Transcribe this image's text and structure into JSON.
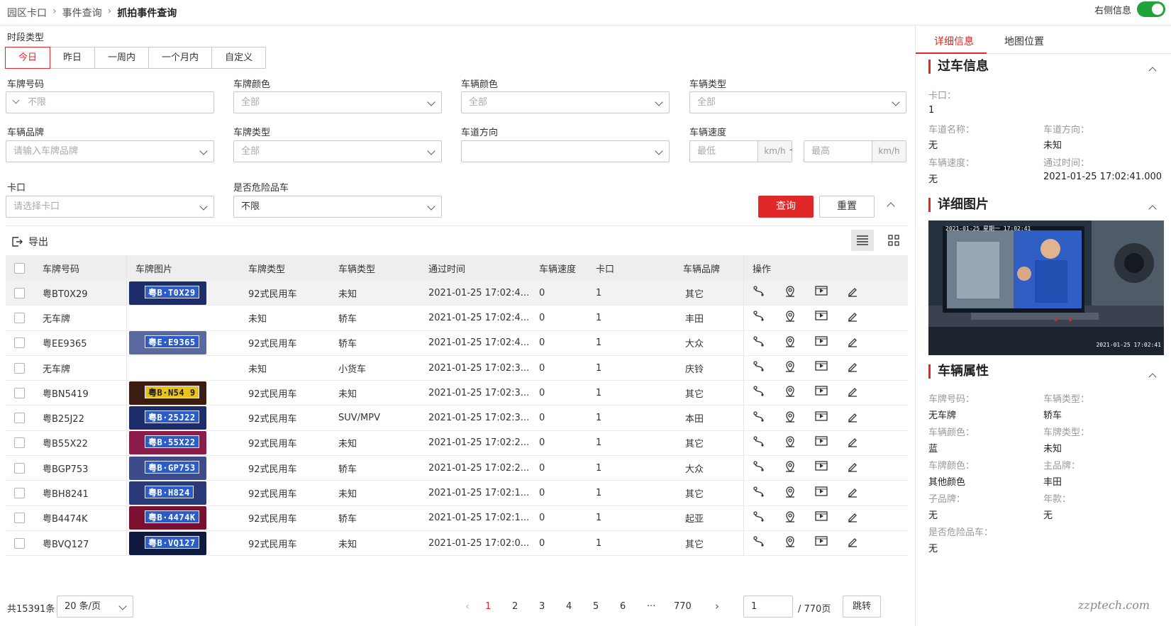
{
  "breadcrumb": {
    "items": [
      "园区卡口",
      "事件查询",
      "抓拍事件查询"
    ]
  },
  "toggle": {
    "label": "右侧信息",
    "on": true
  },
  "filters": {
    "period_label": "时段类型",
    "period_options": [
      "今日",
      "昨日",
      "一周内",
      "一个月内",
      "自定义"
    ],
    "plate_no": {
      "label": "车牌号码",
      "placeholder": "不限"
    },
    "plate_color": {
      "label": "车牌颜色",
      "value": "全部"
    },
    "vehicle_color": {
      "label": "车辆颜色",
      "value": "全部"
    },
    "vehicle_type": {
      "label": "车辆类型",
      "value": "全部"
    },
    "brand": {
      "label": "车辆品牌",
      "placeholder": "请输入车牌品牌"
    },
    "plate_type": {
      "label": "车牌类型",
      "value": "全部"
    },
    "lane_dir": {
      "label": "车道方向",
      "value": ""
    },
    "speed": {
      "label": "车辆速度",
      "min": "最低",
      "max": "最高",
      "unit": "km/h",
      "dash": "-"
    },
    "checkpoint": {
      "label": "卡口",
      "placeholder": "请选择卡口"
    },
    "hazard": {
      "label": "是否危险品车",
      "value": "不限"
    },
    "query_btn": "查询",
    "reset_btn": "重置"
  },
  "export_label": "导出",
  "table": {
    "headers": [
      "车牌号码",
      "车牌图片",
      "车牌类型",
      "车辆类型",
      "通过时间",
      "车辆速度",
      "卡口",
      "车辆品牌",
      "操作"
    ],
    "rows": [
      {
        "plate": "粤BT0X29",
        "img": "粤B·T0X29",
        "ptype": "92式民用车",
        "vtype": "未知",
        "time": "2021-01-25 17:02:4...",
        "speed": "0",
        "cp": "1",
        "brand": "其它",
        "bg": "#1d2d6b",
        "tc": "#2c5cc8"
      },
      {
        "plate": "无车牌",
        "img": "",
        "ptype": "未知",
        "vtype": "轿车",
        "time": "2021-01-25 17:02:4...",
        "speed": "0",
        "cp": "1",
        "brand": "丰田",
        "bg": "",
        "tc": ""
      },
      {
        "plate": "粤EE9365",
        "img": "粤E·E9365",
        "ptype": "92式民用车",
        "vtype": "轿车",
        "time": "2021-01-25 17:02:4...",
        "speed": "0",
        "cp": "1",
        "brand": "大众",
        "bg": "#5a6aa0",
        "tc": "#2c5cc8"
      },
      {
        "plate": "无车牌",
        "img": "",
        "ptype": "未知",
        "vtype": "小货车",
        "time": "2021-01-25 17:02:3...",
        "speed": "0",
        "cp": "1",
        "brand": "庆铃",
        "bg": "",
        "tc": ""
      },
      {
        "plate": "粤BN5419",
        "img": "粤B·N54 9",
        "ptype": "92式民用车",
        "vtype": "未知",
        "time": "2021-01-25 17:02:3...",
        "speed": "0",
        "cp": "1",
        "brand": "其它",
        "bg": "#3a1d10",
        "tc": "#e8c21a"
      },
      {
        "plate": "粤B25J22",
        "img": "粤B·25J22",
        "ptype": "92式民用车",
        "vtype": "SUV/MPV",
        "time": "2021-01-25 17:02:3...",
        "speed": "0",
        "cp": "1",
        "brand": "本田",
        "bg": "#1d2d6b",
        "tc": "#2c5cc8"
      },
      {
        "plate": "粤B55X22",
        "img": "粤B·55X22",
        "ptype": "92式民用车",
        "vtype": "未知",
        "time": "2021-01-25 17:02:2...",
        "speed": "0",
        "cp": "1",
        "brand": "其它",
        "bg": "#8a1d4a",
        "tc": "#2c5cc8"
      },
      {
        "plate": "粤BGP753",
        "img": "粤B·GP753",
        "ptype": "92式民用车",
        "vtype": "轿车",
        "time": "2021-01-25 17:02:2...",
        "speed": "0",
        "cp": "1",
        "brand": "大众",
        "bg": "#3d4c88",
        "tc": "#2c5cc8"
      },
      {
        "plate": "粤BH8241",
        "img": "粤B·H824",
        "ptype": "92式民用车",
        "vtype": "未知",
        "time": "2021-01-25 17:02:1...",
        "speed": "0",
        "cp": "1",
        "brand": "其它",
        "bg": "#2a3a7a",
        "tc": "#2c5cc8"
      },
      {
        "plate": "粤B4474K",
        "img": "粤B·4474K",
        "ptype": "92式民用车",
        "vtype": "轿车",
        "time": "2021-01-25 17:02:1...",
        "speed": "0",
        "cp": "1",
        "brand": "起亚",
        "bg": "#7a1030",
        "tc": "#2c5cc8"
      },
      {
        "plate": "粤BVQ127",
        "img": "粤B·VQ127",
        "ptype": "92式民用车",
        "vtype": "未知",
        "time": "2021-01-25 17:02:0...",
        "speed": "0",
        "cp": "1",
        "brand": "其它",
        "bg": "#0e1a40",
        "tc": "#2c5cc8"
      }
    ]
  },
  "pager": {
    "total": "共15391条",
    "page_size": "20 条/页",
    "pages": [
      "1",
      "2",
      "3",
      "4",
      "5",
      "6",
      "···",
      "770"
    ],
    "current": "1",
    "jump_value": "1",
    "of": "/ 770页",
    "jump_btn": "跳转"
  },
  "detail": {
    "tabs": [
      "详细信息",
      "地图位置"
    ],
    "pass_title": "过车信息",
    "pass": {
      "cp_k": "卡口：",
      "cp_v": "1",
      "lane_k": "车道名称：",
      "lane_v": "无",
      "dir_k": "车道方向：",
      "dir_v": "未知",
      "speed_k": "车辆速度：",
      "speed_v": "无",
      "time_k": "通过时间：",
      "time_v": "2021-01-25 17:02:41.000"
    },
    "img_title": "详细图片",
    "img_text_tl": "2021-01-25 星期一 17:02:41",
    "img_text_br": "2021-01-25 17:02:41",
    "attr_title": "车辆属性",
    "attr": [
      {
        "k": "车牌号码：",
        "v": "无车牌"
      },
      {
        "k": "车辆类型：",
        "v": "轿车"
      },
      {
        "k": "车辆颜色：",
        "v": "蓝"
      },
      {
        "k": "车牌类型：",
        "v": "未知"
      },
      {
        "k": "车牌颜色：",
        "v": "其他颜色"
      },
      {
        "k": "主品牌：",
        "v": "丰田"
      },
      {
        "k": "子品牌：",
        "v": "无"
      },
      {
        "k": "年款：",
        "v": "无"
      },
      {
        "k": "是否危险品车：",
        "v": "无"
      }
    ]
  },
  "watermark": "zzptech.com",
  "colors": {
    "accent": "#e02828",
    "toggle": "#21a33b"
  }
}
